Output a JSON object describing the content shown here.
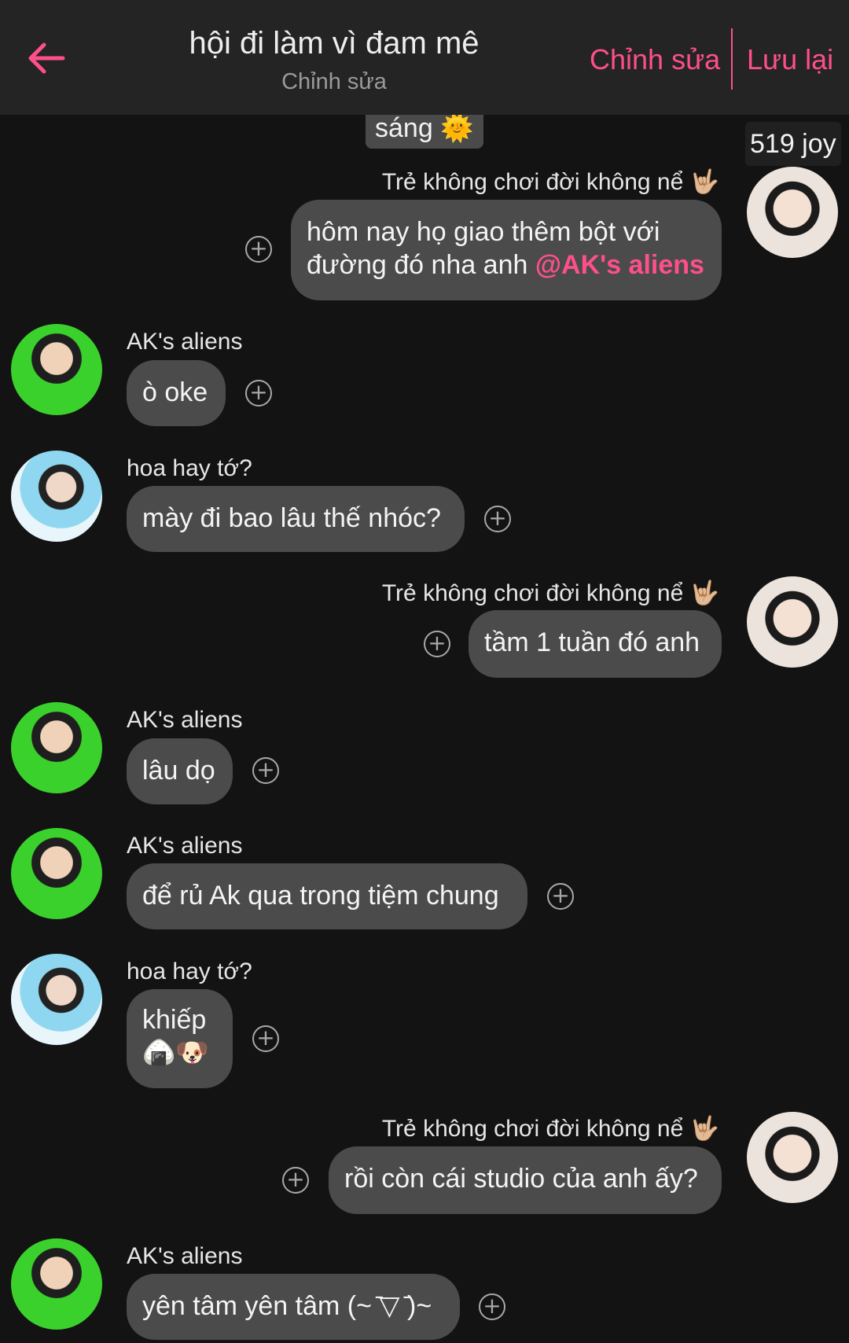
{
  "header": {
    "title": "hội đi làm vì đam mê",
    "subtitle": "Chỉnh sửa",
    "edit_label": "Chỉnh sửa",
    "save_label": "Lưu lại",
    "accent": "#ff4f8b"
  },
  "date_pill": {
    "text": "sáng",
    "emoji": "🌞"
  },
  "joy_badge": "519 joy",
  "messages": [
    {
      "side": "right",
      "sender": "Trẻ không chơi đời không nể",
      "sender_emoji": "🤟🏼",
      "lines": [
        "hôm nay họ giao thêm bột với",
        "đường đó nha anh"
      ],
      "mention": "@AK's aliens",
      "avatar": "boy-avatar"
    },
    {
      "side": "left",
      "sender": "AK's aliens",
      "text": "ò oke",
      "avatar": "green-shirt-avatar"
    },
    {
      "side": "left",
      "sender": "hoa hay tớ?",
      "text": "mày đi bao lâu thế nhóc?",
      "avatar": "pool-avatar"
    },
    {
      "side": "right",
      "sender": "Trẻ không chơi đời không nể",
      "sender_emoji": "🤟🏼",
      "text": "tầm 1 tuần đó anh",
      "avatar": "boy-avatar"
    },
    {
      "side": "left",
      "sender": "AK's aliens",
      "text": "lâu dọ",
      "avatar": "green-shirt-avatar"
    },
    {
      "side": "left",
      "sender": "AK's aliens",
      "text": "để rủ Ak qua trong tiệm chung",
      "avatar": "green-shirt-avatar"
    },
    {
      "side": "left",
      "sender": "hoa hay tớ?",
      "text": "khiếp",
      "emojis": "🍙🐶",
      "avatar": "pool-avatar"
    },
    {
      "side": "right",
      "sender": "Trẻ không chơi đời không nể",
      "sender_emoji": "🤟🏼",
      "text": "rồi còn cái studio của anh ấy?",
      "avatar": "boy-avatar"
    },
    {
      "side": "left",
      "sender": "AK's aliens",
      "text": "yên tâm yên tâm (~ ̄▽ ̄)~",
      "avatar": "green-shirt-avatar"
    }
  ]
}
